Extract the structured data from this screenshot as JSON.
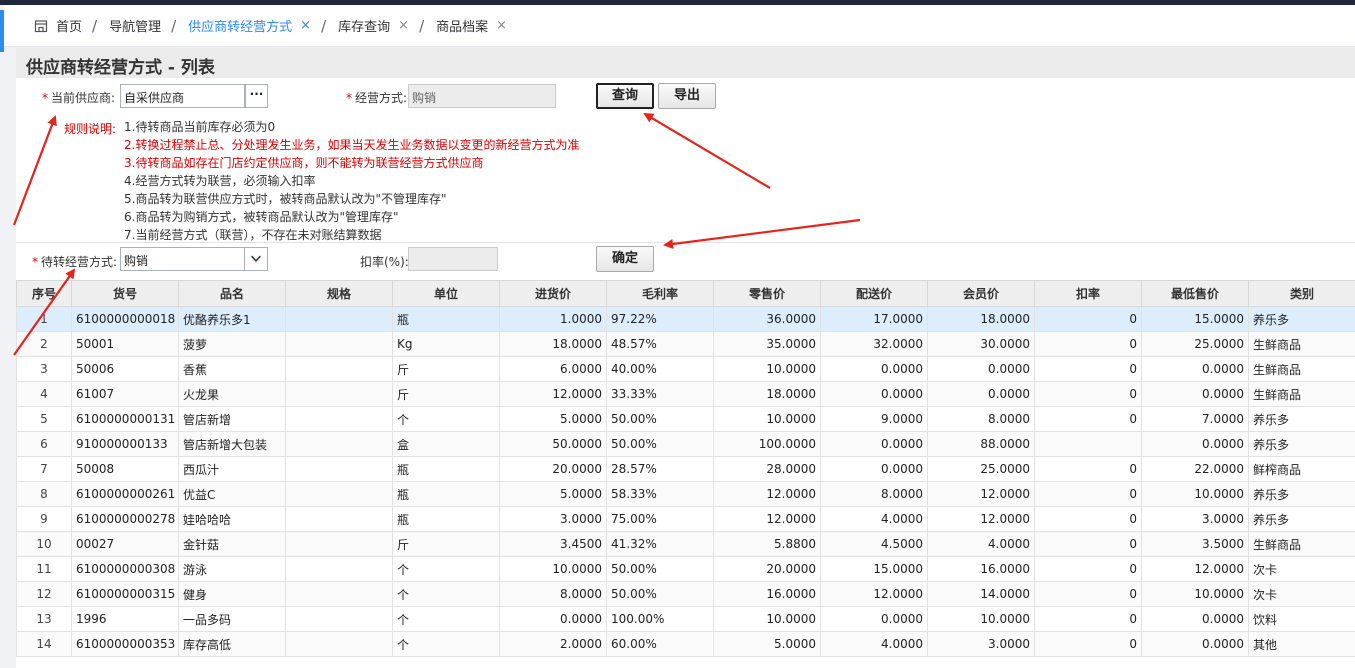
{
  "tabs": {
    "home": "首页",
    "nav": "导航管理",
    "active": "供应商转经营方式",
    "inventory": "库存查询",
    "products": "商品档案",
    "close": "×",
    "sep": "/"
  },
  "page": {
    "title": "供应商转经营方式 - 列表"
  },
  "form": {
    "required_mark": "*",
    "supplier_label": "当前供应商:",
    "supplier_value": "自采供应商",
    "ellipsis": "···",
    "mode_label": "经营方式:",
    "mode_value": "购销",
    "query_button": "查询",
    "export_button": "导出",
    "rules_label": "规则说明:",
    "rules": [
      "1.待转商品当前库存必须为0",
      "2.转换过程禁止总、分处理发生业务，如果当天发生业务数据以变更的新经营方式为准",
      "3.待转商品如存在门店约定供应商，则不能转为联营经营方式供应商",
      "4.经营方式转为联营，必须输入扣率",
      "5.商品转为联营供应方式时，被转商品默认改为\"不管理库存\"",
      "6.商品转为购销方式，被转商品默认改为\"管理库存\"",
      "7.当前经营方式（联营），不存在未对账结算数据"
    ],
    "target_mode_label": "待转经营方式:",
    "target_mode_value": "购销",
    "rate_label": "扣率(%):",
    "rate_value": "",
    "confirm_button": "确定"
  },
  "table": {
    "columns": [
      "序号",
      "货号",
      "品名",
      "规格",
      "单位",
      "进货价",
      "毛利率",
      "零售价",
      "配送价",
      "会员价",
      "扣率",
      "最低售价",
      "类别"
    ],
    "rows": [
      [
        "1",
        "6100000000018",
        "优酪养乐多1",
        "",
        "瓶",
        "1.0000",
        "97.22%",
        "36.0000",
        "17.0000",
        "18.0000",
        "0",
        "15.0000",
        "养乐多"
      ],
      [
        "2",
        "50001",
        "菠萝",
        "",
        "Kg",
        "18.0000",
        "48.57%",
        "35.0000",
        "32.0000",
        "30.0000",
        "0",
        "25.0000",
        "生鲜商品"
      ],
      [
        "3",
        "50006",
        "香蕉",
        "",
        "斤",
        "6.0000",
        "40.00%",
        "10.0000",
        "0.0000",
        "0.0000",
        "0",
        "0.0000",
        "生鲜商品"
      ],
      [
        "4",
        "61007",
        "火龙果",
        "",
        "斤",
        "12.0000",
        "33.33%",
        "18.0000",
        "0.0000",
        "0.0000",
        "0",
        "0.0000",
        "生鲜商品"
      ],
      [
        "5",
        "6100000000131",
        "管店新增",
        "",
        "个",
        "5.0000",
        "50.00%",
        "10.0000",
        "9.0000",
        "8.0000",
        "0",
        "7.0000",
        "养乐多"
      ],
      [
        "6",
        "910000000133",
        "管店新增大包装",
        "",
        "盒",
        "50.0000",
        "50.00%",
        "100.0000",
        "0.0000",
        "88.0000",
        "",
        "0.0000",
        "养乐多"
      ],
      [
        "7",
        "50008",
        "西瓜汁",
        "",
        "瓶",
        "20.0000",
        "28.57%",
        "28.0000",
        "0.0000",
        "25.0000",
        "0",
        "22.0000",
        "鲜榨商品"
      ],
      [
        "8",
        "6100000000261",
        "优益C",
        "",
        "瓶",
        "5.0000",
        "58.33%",
        "12.0000",
        "8.0000",
        "12.0000",
        "0",
        "10.0000",
        "养乐多"
      ],
      [
        "9",
        "6100000000278",
        "娃哈哈哈",
        "",
        "瓶",
        "3.0000",
        "75.00%",
        "12.0000",
        "4.0000",
        "12.0000",
        "0",
        "3.0000",
        "养乐多"
      ],
      [
        "10",
        "00027",
        "金针菇",
        "",
        "斤",
        "3.4500",
        "41.32%",
        "5.8800",
        "4.5000",
        "4.0000",
        "0",
        "3.5000",
        "生鲜商品"
      ],
      [
        "11",
        "6100000000308",
        "游泳",
        "",
        "个",
        "10.0000",
        "50.00%",
        "20.0000",
        "15.0000",
        "16.0000",
        "0",
        "12.0000",
        "次卡"
      ],
      [
        "12",
        "6100000000315",
        "健身",
        "",
        "个",
        "8.0000",
        "50.00%",
        "16.0000",
        "12.0000",
        "14.0000",
        "0",
        "10.0000",
        "次卡"
      ],
      [
        "13",
        "1996",
        "一品多码",
        "",
        "个",
        "0.0000",
        "100.00%",
        "10.0000",
        "0.0000",
        "10.0000",
        "0",
        "0.0000",
        "饮料"
      ],
      [
        "14",
        "6100000000353",
        "库存高低",
        "",
        "个",
        "2.0000",
        "60.00%",
        "5.0000",
        "4.0000",
        "3.0000",
        "0",
        "0.0000",
        "其他"
      ]
    ]
  },
  "colors": {
    "accent": "#2d8cf0",
    "annotation": "#e8231b"
  },
  "icons": {
    "home": "home-icon",
    "tab_close": "close-icon",
    "lookup": "ellipsis-icon",
    "dropdown": "chevron-down-icon"
  }
}
